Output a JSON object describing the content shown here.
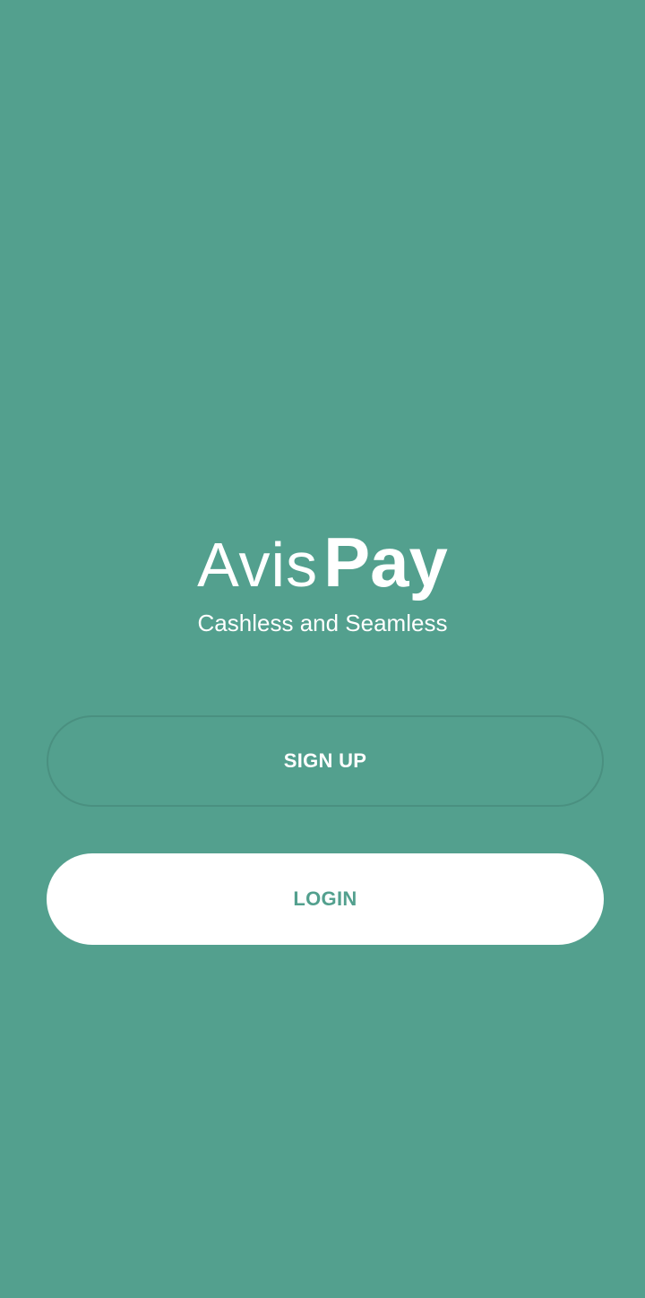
{
  "brand": {
    "name_light": "Avis",
    "name_bold": "Pay",
    "tagline": "Cashless and Seamless"
  },
  "actions": {
    "signup_label": "SIGN UP",
    "login_label": "LOGIN"
  },
  "colors": {
    "background": "#53a08e",
    "button_text_on_white": "#53a08e",
    "white": "#ffffff"
  }
}
